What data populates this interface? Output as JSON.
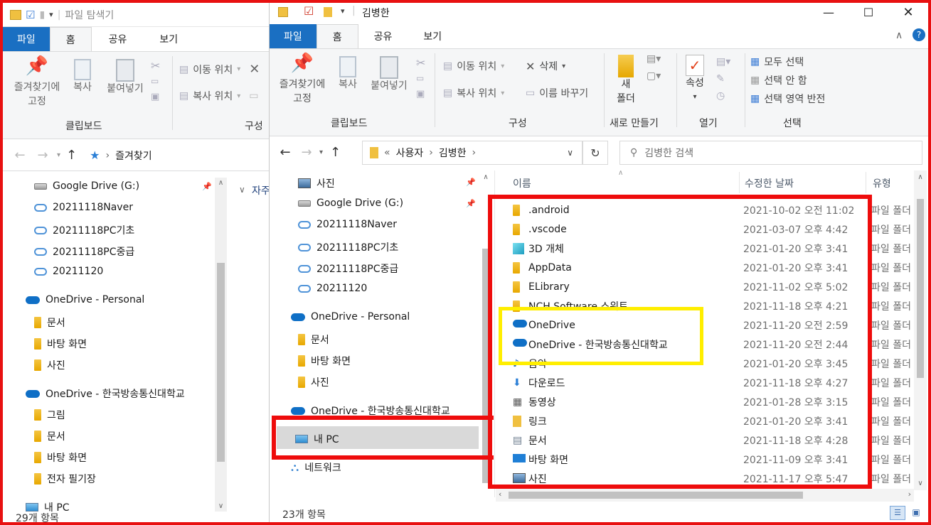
{
  "back_window": {
    "title": "파일 탐색기",
    "tabs": [
      "파일",
      "홈",
      "공유",
      "보기"
    ],
    "ribbon": {
      "pin_label": "즐겨찾기에\n고정",
      "copy_label": "복사",
      "paste_label": "붙여넣기",
      "move_to": "이동 위치",
      "copy_to": "복사 위치",
      "group_clipboard": "클립보드",
      "group_organize": "구성"
    },
    "address": "즐겨찾기",
    "tree": [
      {
        "label": "Google Drive (G:)",
        "icon": "drive-icon",
        "pinned": true
      },
      {
        "label": "20211118Naver",
        "icon": "cloud-folder-icon"
      },
      {
        "label": "20211118PC기초",
        "icon": "cloud-folder-icon"
      },
      {
        "label": "20211118PC중급",
        "icon": "cloud-folder-icon"
      },
      {
        "label": "20211120",
        "icon": "cloud-folder-icon"
      },
      {
        "label": "OneDrive - Personal",
        "icon": "onedrive-icon"
      },
      {
        "label": "문서",
        "icon": "folder-icon"
      },
      {
        "label": "바탕 화면",
        "icon": "folder-icon"
      },
      {
        "label": "사진",
        "icon": "folder-icon"
      },
      {
        "label": "OneDrive - 한국방송통신대학교",
        "icon": "onedrive-icon"
      },
      {
        "label": "그림",
        "icon": "folder-icon"
      },
      {
        "label": "문서",
        "icon": "folder-icon"
      },
      {
        "label": "바탕 화면",
        "icon": "folder-icon"
      },
      {
        "label": "전자 필기장",
        "icon": "folder-icon"
      },
      {
        "label": "내 PC",
        "icon": "pc-icon"
      }
    ],
    "content_partial": "자주",
    "status": "29개 항목"
  },
  "front_window": {
    "title": "김병한",
    "tabs": [
      "파일",
      "홈",
      "공유",
      "보기"
    ],
    "ribbon": {
      "pin_label": "즐겨찾기에\n고정",
      "copy_label": "복사",
      "paste_label": "붙여넣기",
      "move_to": "이동 위치",
      "copy_to": "복사 위치",
      "delete": "삭제",
      "rename": "이름 바꾸기",
      "new_folder": "새\n폴더",
      "properties": "속성",
      "select_all": "모두 선택",
      "select_none": "선택 안 함",
      "invert_selection": "선택 영역 반전",
      "group_clipboard": "클립보드",
      "group_organize": "구성",
      "group_new": "새로 만들기",
      "group_open": "열기",
      "group_select": "선택"
    },
    "breadcrumb": [
      "사용자",
      "김병한"
    ],
    "search_placeholder": "김병한 검색",
    "tree": [
      {
        "label": "사진",
        "icon": "picture-icon",
        "pinned": true
      },
      {
        "label": "Google Drive (G:)",
        "icon": "drive-icon",
        "pinned": true
      },
      {
        "label": "20211118Naver",
        "icon": "cloud-folder-icon"
      },
      {
        "label": "20211118PC기초",
        "icon": "cloud-folder-icon"
      },
      {
        "label": "20211118PC중급",
        "icon": "cloud-folder-icon"
      },
      {
        "label": "20211120",
        "icon": "cloud-folder-icon"
      },
      {
        "label": "OneDrive - Personal",
        "icon": "onedrive-icon"
      },
      {
        "label": "문서",
        "icon": "folder-icon"
      },
      {
        "label": "바탕 화면",
        "icon": "folder-icon"
      },
      {
        "label": "사진",
        "icon": "folder-icon"
      },
      {
        "label": "OneDrive - 한국방송통신대학교",
        "icon": "onedrive-icon"
      },
      {
        "label": "내 PC",
        "icon": "pc-icon",
        "selected": true
      },
      {
        "label": "네트워크",
        "icon": "network-icon"
      }
    ],
    "columns": {
      "name": "이름",
      "modified": "수정한 날짜",
      "type": "유형"
    },
    "files": [
      {
        "name": ".android",
        "date": "2021-10-02 오전 11:02",
        "type": "파일 폴더",
        "icon": "folder-icon"
      },
      {
        "name": ".vscode",
        "date": "2021-03-07 오후 4:42",
        "type": "파일 폴더",
        "icon": "folder-icon"
      },
      {
        "name": "3D 개체",
        "date": "2021-01-20 오후 3:41",
        "type": "파일 폴더",
        "icon": "3d-objects-icon"
      },
      {
        "name": "AppData",
        "date": "2021-01-20 오후 3:41",
        "type": "파일 폴더",
        "icon": "folder-icon"
      },
      {
        "name": "ELibrary",
        "date": "2021-11-02 오후 5:02",
        "type": "파일 폴더",
        "icon": "folder-icon"
      },
      {
        "name": "NCH Software 스위트",
        "date": "2021-11-18 오후 4:21",
        "type": "파일 폴더",
        "icon": "folder-icon"
      },
      {
        "name": "OneDrive",
        "date": "2021-11-20 오전 2:59",
        "type": "파일 폴더",
        "icon": "onedrive-icon"
      },
      {
        "name": "OneDrive - 한국방송통신대학교",
        "date": "2021-11-20 오전 2:44",
        "type": "파일 폴더",
        "icon": "onedrive-icon"
      },
      {
        "name": "음악",
        "date": "2021-01-20 오후 3:45",
        "type": "파일 폴더",
        "icon": "music-icon"
      },
      {
        "name": "다운로드",
        "date": "2021-11-18 오후 4:27",
        "type": "파일 폴더",
        "icon": "download-icon"
      },
      {
        "name": "동영상",
        "date": "2021-01-28 오후 3:15",
        "type": "파일 폴더",
        "icon": "video-icon"
      },
      {
        "name": "링크",
        "date": "2021-01-20 오후 3:41",
        "type": "파일 폴더",
        "icon": "link-icon"
      },
      {
        "name": "문서",
        "date": "2021-11-18 오후 4:28",
        "type": "파일 폴더",
        "icon": "document-icon"
      },
      {
        "name": "바탕 화면",
        "date": "2021-11-09 오후 3:41",
        "type": "파일 폴더",
        "icon": "desktop-icon"
      },
      {
        "name": "사진",
        "date": "2021-11-17 오후 5:47",
        "type": "파일 폴더",
        "icon": "picture-icon"
      }
    ],
    "status": "23개 항목"
  },
  "colors": {
    "highlight_red": "#ee0c0c",
    "highlight_yellow": "#ffee00",
    "file_tab": "#1a6fc2",
    "selected_nav": "#d9d9d9"
  }
}
